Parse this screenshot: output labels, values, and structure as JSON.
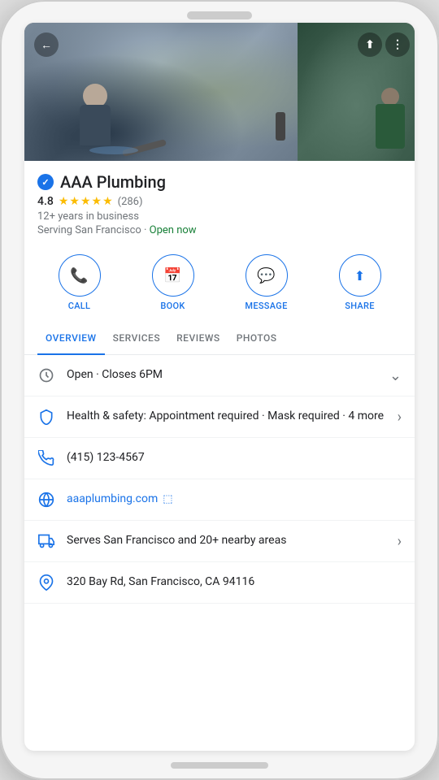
{
  "business": {
    "name": "AAA Plumbing",
    "verified": true,
    "rating": "4.8",
    "review_count": "(286)",
    "years_in_business": "12+ years in business",
    "serving": "Serving San Francisco",
    "status": "Open now",
    "hours_summary": "Open · Closes 6PM",
    "phone": "(415) 123-4567",
    "website": "aaaplumbing.com",
    "service_area": "Serves San Francisco and 20+ nearby areas",
    "address": "320 Bay Rd, San Francisco, CA 94116",
    "health_safety": "Health & safety: Appointment required · Mask required · 4 more"
  },
  "actions": [
    {
      "id": "call",
      "label": "CALL",
      "icon": "☎"
    },
    {
      "id": "book",
      "label": "BOOK",
      "icon": "📅"
    },
    {
      "id": "message",
      "label": "MESSAGE",
      "icon": "💬"
    },
    {
      "id": "share",
      "label": "SHARE",
      "icon": "↗"
    }
  ],
  "tabs": [
    {
      "id": "overview",
      "label": "OVERVIEW",
      "active": true
    },
    {
      "id": "services",
      "label": "SERVICES",
      "active": false
    },
    {
      "id": "reviews",
      "label": "REVIEWS",
      "active": false
    },
    {
      "id": "photos",
      "label": "PHOTOS",
      "active": false
    }
  ],
  "header": {
    "back_label": "←",
    "share_label": "⬆",
    "more_label": "⋮"
  },
  "stars": [
    "★",
    "★",
    "★",
    "★",
    "★"
  ]
}
